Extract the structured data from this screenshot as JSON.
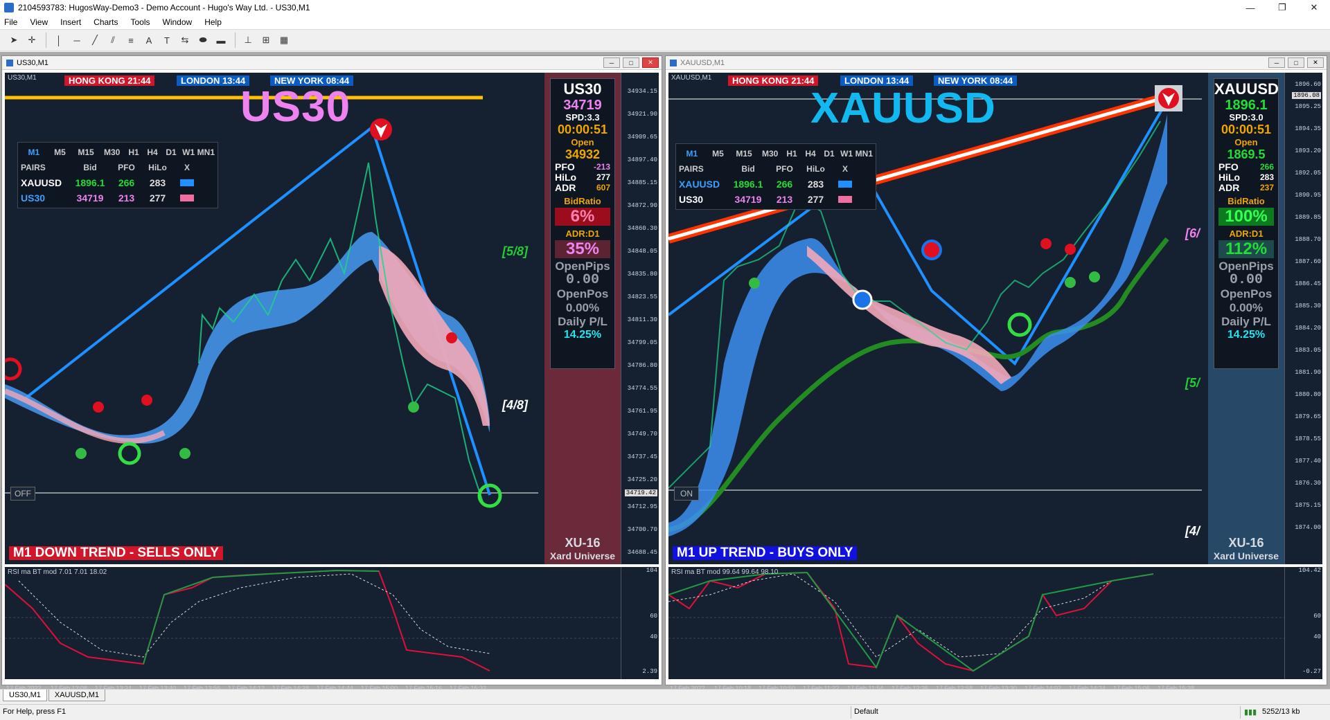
{
  "window": {
    "title": "2104593783: HugosWay-Demo3 - Demo Account - Hugo's Way Ltd. - US30,M1",
    "min": "—",
    "restore": "❐",
    "close": "✕"
  },
  "menu": [
    "File",
    "View",
    "Insert",
    "Charts",
    "Tools",
    "Window",
    "Help"
  ],
  "toolbar_icons": [
    "cursor-icon",
    "crosshair-icon",
    "vertical-line-icon",
    "horizontal-line-icon",
    "trendline-icon",
    "channel-icon",
    "fibonacci-icon",
    "text-icon",
    "text-label-icon",
    "arrows-icon",
    "ellipse-icon",
    "rectangle-icon",
    "period-icon",
    "zoom-icon",
    "tile-icon"
  ],
  "sessions": [
    {
      "label": "HONG KONG 21:44",
      "color": "#d01628"
    },
    {
      "label": "LONDON  13:44",
      "color": "#0b5cc5"
    },
    {
      "label": "NEW YORK  08:44",
      "color": "#0b5cc5"
    }
  ],
  "pairs_table": {
    "timeframes": [
      "M1",
      "M5",
      "M15",
      "M30",
      "H1",
      "H4",
      "D1",
      "W1",
      "MN1"
    ],
    "headers": [
      "PAIRS",
      "Bid",
      "PFO",
      "HiLo",
      "X"
    ],
    "rows": [
      {
        "pair": "XAUUSD",
        "bid": "1896.1",
        "pfo": "266",
        "hilo": "283",
        "color": "#1e90ff"
      },
      {
        "pair": "US30",
        "bid": "34719",
        "pfo": "213",
        "hilo": "277",
        "color": "#f06ea0"
      }
    ]
  },
  "charts": [
    {
      "tab": "US30,M1",
      "label": "US30,M1",
      "big_symbol": "US30",
      "big_color": "#ee82ee",
      "info": {
        "sym": "US30",
        "bid": "34719",
        "bid_color": "#ee82ee",
        "spd": "SPD:3.3",
        "time": "00:00:51",
        "open_lbl": "Open",
        "open": "34932",
        "pfo_lbl": "PFO",
        "pfo": "-213",
        "pfo_color": "#ee82ee",
        "hilo_lbl": "HiLo",
        "hilo": "277",
        "adr_lbl": "ADR",
        "adr": "607",
        "adr_color": "#f0a500",
        "bidratio_lbl": "BidRatio",
        "bidratio": "6%",
        "bidratio_bg": "#9b0c1c",
        "bidratio_color": "#ff7fb0",
        "adrd1_lbl": "ADR:D1",
        "adrd1": "35%",
        "adrd1_bg": "#5c2333",
        "adrd1_color": "#ee82ee",
        "openpips_lbl": "OpenPips",
        "openpips": "0.00",
        "openpos_lbl": "OpenPos",
        "openpos": "0.00%",
        "daily_lbl": "Daily P/L",
        "daily": "14.25%"
      },
      "panel_bg": "#6b2a3a",
      "brand1": "XU-16",
      "brand2": "Xard Universe",
      "trend": "M1  DOWN TREND - SELLS ONLY",
      "trend_bg": "#d01628",
      "toggle": "OFF",
      "murrey": [
        {
          "text": "[5/8]",
          "color": "#22cc33"
        },
        {
          "text": "[4/8]",
          "color": "#ffffff"
        }
      ],
      "price_ticks": [
        "34934.15",
        "34921.90",
        "34909.65",
        "34897.40",
        "34885.15",
        "34872.90",
        "34860.30",
        "34848.05",
        "34835.80",
        "34823.55",
        "34811.30",
        "34799.05",
        "34786.80",
        "34774.55",
        "34761.95",
        "34749.70",
        "34737.45",
        "34725.20",
        "34712.95",
        "34700.70",
        "34688.45"
      ],
      "current_price": "34719.42",
      "rsi_title": "RSI ma BT mod 7.01 7.01 18.02",
      "rsi_ticks": [
        "104",
        "60",
        "40",
        "2.39"
      ],
      "times": [
        "17 Feb 2022",
        "17 Feb 13:08",
        "17 Feb 13:24",
        "17 Feb 13:40",
        "17 Feb 13:56",
        "17 Feb 14:12",
        "17 Feb 14:28",
        "17 Feb 14:44",
        "17 Feb 15:00",
        "17 Feb 15:16",
        "17 Feb 15:32"
      ]
    },
    {
      "tab": "XAUUSD,M1",
      "label": "XAUUSD,M1",
      "big_symbol": "XAUUSD",
      "big_color": "#12b8f0",
      "info": {
        "sym": "XAUUSD",
        "bid": "1896.1",
        "bid_color": "#22dd33",
        "spd": "SPD:3.0",
        "time": "00:00:51",
        "open_lbl": "Open",
        "open": "1869.5",
        "pfo_lbl": "PFO",
        "pfo": "266",
        "pfo_color": "#22dd33",
        "hilo_lbl": "HiLo",
        "hilo": "283",
        "adr_lbl": "ADR",
        "adr": "237",
        "adr_color": "#f0a500",
        "bidratio_lbl": "BidRatio",
        "bidratio": "100%",
        "bidratio_bg": "#0e7a20",
        "bidratio_color": "#33ff55",
        "adrd1_lbl": "ADR:D1",
        "adrd1": "112%",
        "adrd1_bg": "#1d4a4a",
        "adrd1_color": "#22dd33",
        "openpips_lbl": "OpenPips",
        "openpips": "0.00",
        "openpos_lbl": "OpenPos",
        "openpos": "0.00%",
        "daily_lbl": "Daily P/L",
        "daily": "14.25%"
      },
      "panel_bg": "#284868",
      "brand1": "XU-16",
      "brand2": "Xard Universe",
      "trend": "M1 UP TREND - BUYS ONLY",
      "trend_bg": "#1010e0",
      "toggle": "ON",
      "murrey": [
        {
          "text": "[6/",
          "color": "#ee82ee"
        },
        {
          "text": "[5/",
          "color": "#22cc33"
        },
        {
          "text": "[4/",
          "color": "#ffffff"
        }
      ],
      "price_ticks": [
        "1896.60",
        "1896.08",
        "1895.25",
        "1894.35",
        "1893.20",
        "1892.05",
        "1890.95",
        "1889.85",
        "1888.70",
        "1887.60",
        "1886.45",
        "1885.30",
        "1884.20",
        "1883.05",
        "1881.90",
        "1880.80",
        "1879.65",
        "1878.55",
        "1877.40",
        "1876.30",
        "1875.15",
        "1874.00"
      ],
      "current_price": "1896.08",
      "rsi_title": "RSI ma BT mod 99.64 99.64 98.10",
      "rsi_ticks": [
        "104.42",
        "60",
        "40",
        "-0.27"
      ],
      "times": [
        "17 Feb 2022",
        "17 Feb 10:18",
        "17 Feb 10:50",
        "17 Feb 11:22",
        "17 Feb 11:54",
        "17 Feb 12:26",
        "17 Feb 12:58",
        "17 Feb 13:30",
        "17 Feb 14:02",
        "17 Feb 14:34",
        "17 Feb 15:06",
        "17 Feb 15:38"
      ]
    }
  ],
  "tabs": [
    "US30,M1",
    "XAUUSD,M1"
  ],
  "status": {
    "help": "For Help, press F1",
    "profile": "Default",
    "traffic": "5252/13 kb"
  }
}
